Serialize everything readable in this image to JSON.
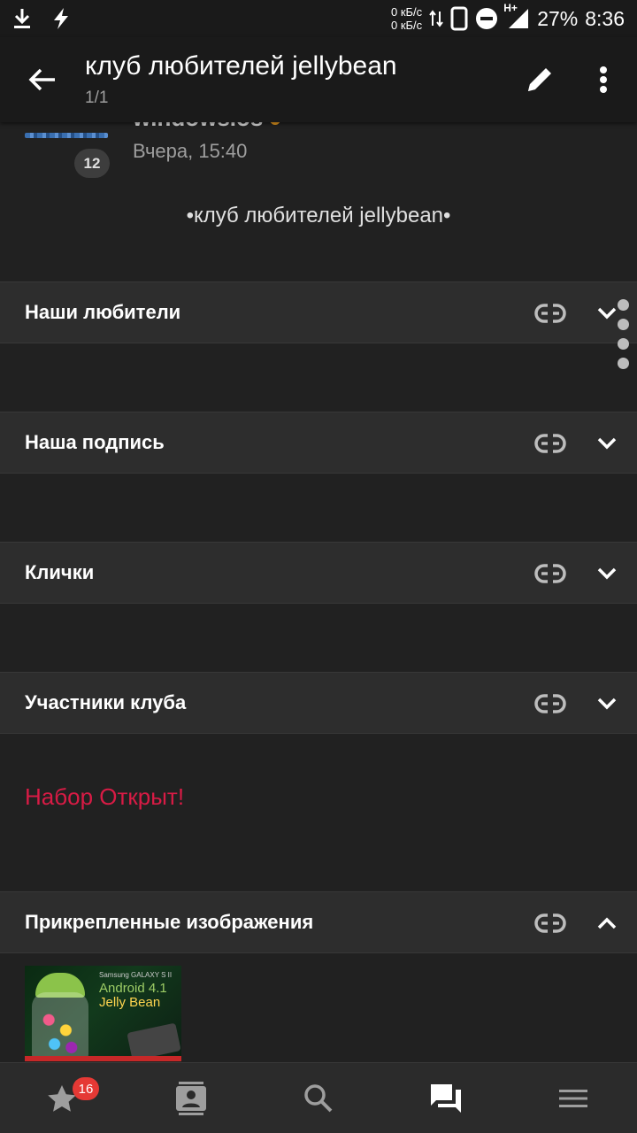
{
  "status_bar": {
    "net_up": "0 кБ/с",
    "net_down": "0 кБ/с",
    "network_type": "H+",
    "battery": "27%",
    "time": "8:36"
  },
  "app_bar": {
    "title": "клуб любителей jellybean",
    "subtitle": "1/1"
  },
  "post": {
    "author": "windows.os",
    "date": "Вчера, 15:40",
    "avatar_count": "12",
    "text": "•клуб любителей jellybean•"
  },
  "sections": [
    {
      "title": "Наши любители"
    },
    {
      "title": "Наша подпись"
    },
    {
      "title": "Клички"
    },
    {
      "title": "Участники клуба"
    },
    {
      "title": "Прикрепленные изображения"
    }
  ],
  "recruit_text": "Набор Открыт!",
  "attachment": {
    "brand": "Samsung GALAXY S II",
    "line1": "Android 4.1",
    "line2": "Jelly Bean"
  },
  "bottom_nav": {
    "favorites_badge": "16"
  },
  "colors": {
    "background": "#212121",
    "section_header": "#2d2d2d",
    "accent_red": "#d81b45",
    "badge_red": "#e53935"
  }
}
